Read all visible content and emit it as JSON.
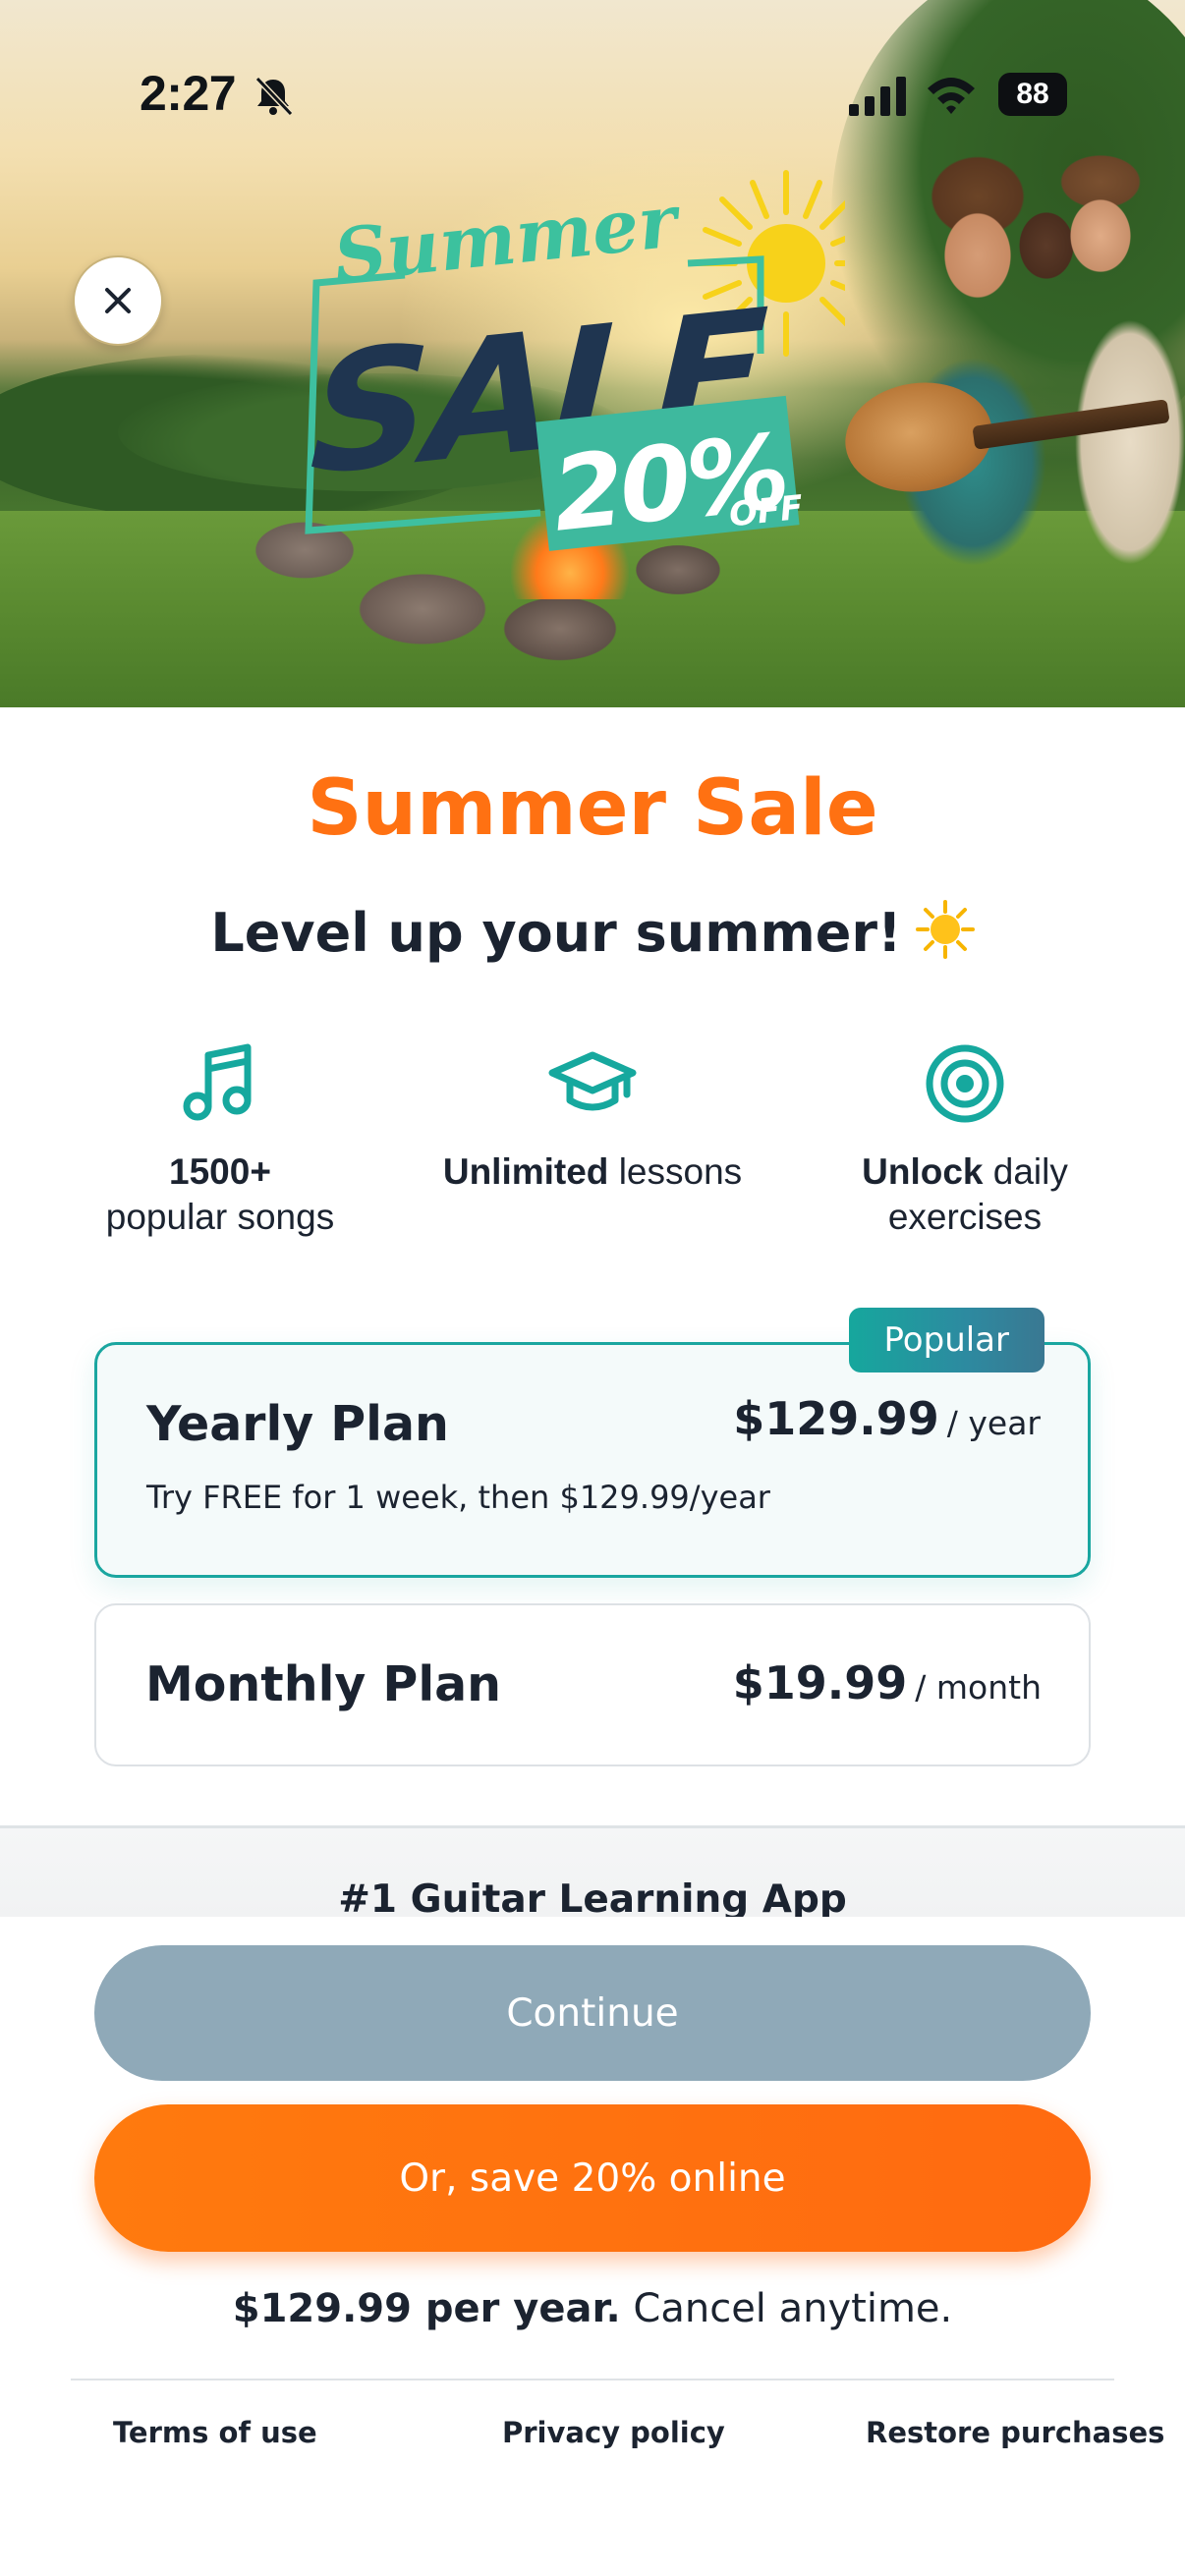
{
  "status_bar": {
    "time": "2:27",
    "battery": "88",
    "icons": [
      "bell-slash-icon",
      "cellular-signal-icon",
      "wifi-icon",
      "battery-icon"
    ]
  },
  "hero": {
    "badge_script": "Summer",
    "badge_sale": "SALE",
    "badge_percent": "20%",
    "badge_off": "OFF"
  },
  "close_button": {
    "icon": "close-icon"
  },
  "header": {
    "title": "Summer Sale",
    "tagline": "Level up your summer!"
  },
  "features": [
    {
      "icon": "music-note-icon",
      "strong": "1500+",
      "rest": "popular songs"
    },
    {
      "icon": "graduation-cap-icon",
      "strong": "Unlimited",
      "rest": "lessons"
    },
    {
      "icon": "target-icon",
      "strong": "Unlock",
      "rest": "daily exercises"
    }
  ],
  "plans": {
    "yearly": {
      "badge": "Popular",
      "name": "Yearly Plan",
      "price": "$129.99",
      "period": "/ year",
      "description": "Try FREE for 1 week, then $129.99/year"
    },
    "monthly": {
      "name": "Monthly Plan",
      "price": "$19.99",
      "period": "/ month"
    }
  },
  "ranking": {
    "text": "#1 Guitar Learning App"
  },
  "actions": {
    "continue_label": "Continue",
    "save_online_label": "Or, save 20% online"
  },
  "price_note": {
    "strong": "$129.99 per year.",
    "rest": "Cancel anytime."
  },
  "footer": {
    "terms": "Terms of use",
    "privacy": "Privacy policy",
    "restore": "Restore purchases"
  },
  "colors": {
    "accent_orange": "#ff7112",
    "teal": "#1aa6a0",
    "continue_disabled": "#8fa9b8",
    "text_dark": "#1b2330"
  }
}
